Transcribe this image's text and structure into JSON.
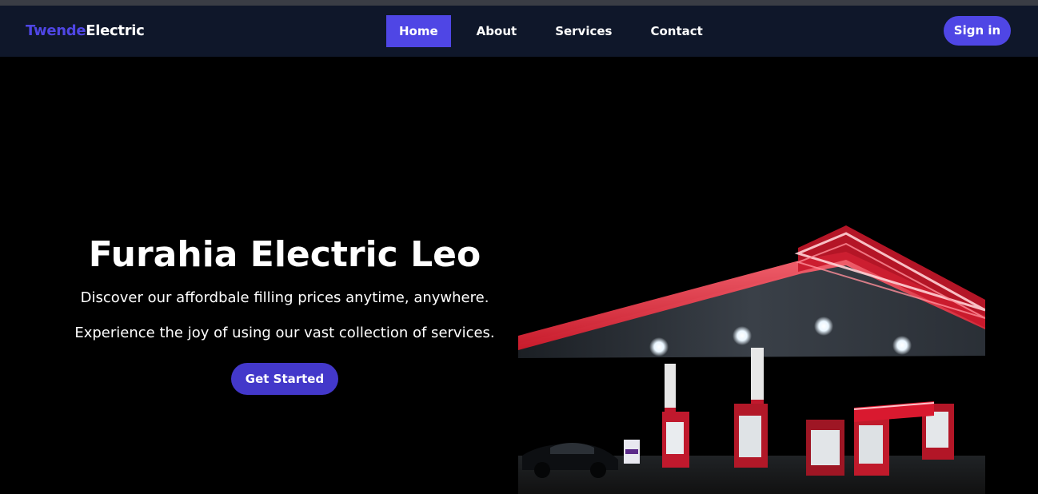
{
  "navbar": {
    "brand": {
      "part1": "Twende",
      "part2": "Electric"
    },
    "links": [
      {
        "label": "Home",
        "active": true
      },
      {
        "label": "About",
        "active": false
      },
      {
        "label": "Services",
        "active": false
      },
      {
        "label": "Contact",
        "active": false
      }
    ],
    "signin_label": "Sign in"
  },
  "hero": {
    "title": "Furahia Electric Leo",
    "line1": "Discover our affordbale filling prices anytime, anywhere.",
    "line2": "Experience the joy of using our vast collection of services.",
    "cta_label": "Get Started"
  },
  "colors": {
    "nav_bg": "#0f172a",
    "accent": "#4f46e5",
    "cta": "#4338ca",
    "canopy_glow": "#ff3b4a"
  },
  "image": {
    "subject": "gas-station-at-night"
  }
}
